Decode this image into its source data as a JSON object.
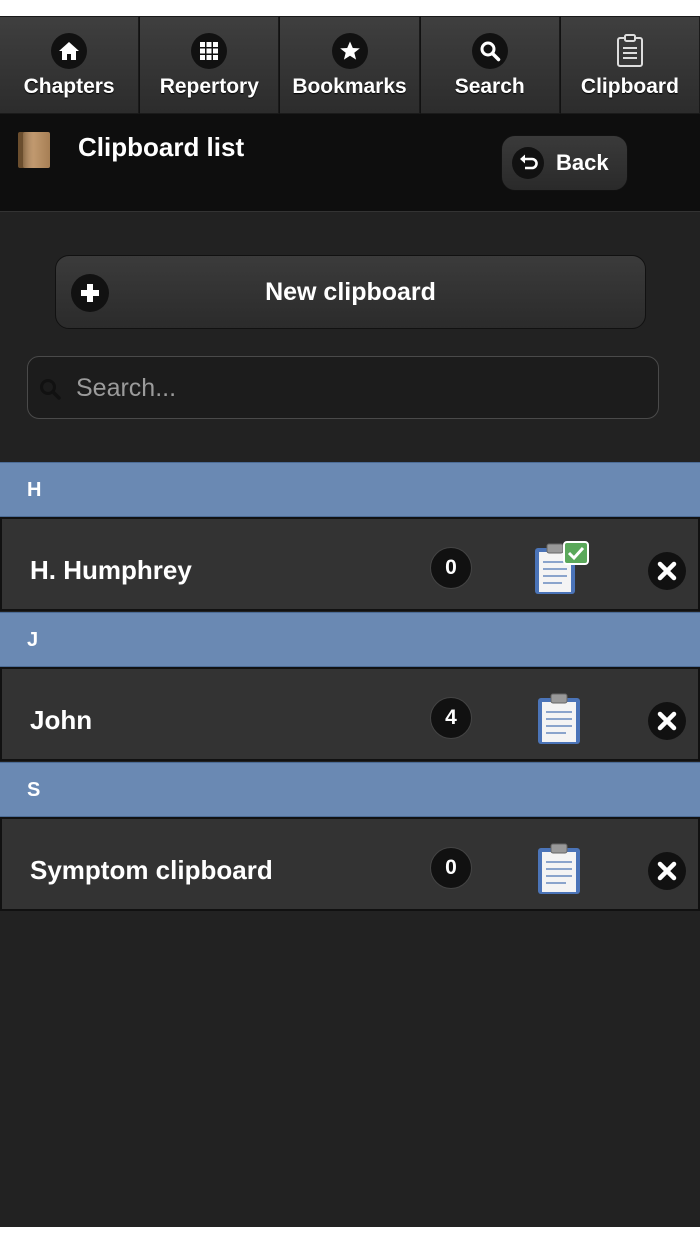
{
  "nav": {
    "items": [
      {
        "label": "Chapters",
        "icon": "home-icon"
      },
      {
        "label": "Repertory",
        "icon": "grid-icon"
      },
      {
        "label": "Bookmarks",
        "icon": "star-icon"
      },
      {
        "label": "Search",
        "icon": "search-icon"
      },
      {
        "label": "Clipboard",
        "icon": "clipboard-icon"
      }
    ]
  },
  "header": {
    "title": "Clipboard list",
    "back_label": "Back"
  },
  "new_clipboard": {
    "label": "New clipboard"
  },
  "search": {
    "placeholder": "Search...",
    "value": ""
  },
  "groups": [
    {
      "letter": "H",
      "items": [
        {
          "name": "H. Humphrey",
          "count": "0",
          "active": true
        }
      ]
    },
    {
      "letter": "J",
      "items": [
        {
          "name": "John",
          "count": "4",
          "active": false
        }
      ]
    },
    {
      "letter": "S",
      "items": [
        {
          "name": "Symptom clipboard",
          "count": "0",
          "active": false
        }
      ]
    }
  ],
  "colors": {
    "divider": "#6a89b3",
    "background": "#222222",
    "row": "#333333"
  }
}
